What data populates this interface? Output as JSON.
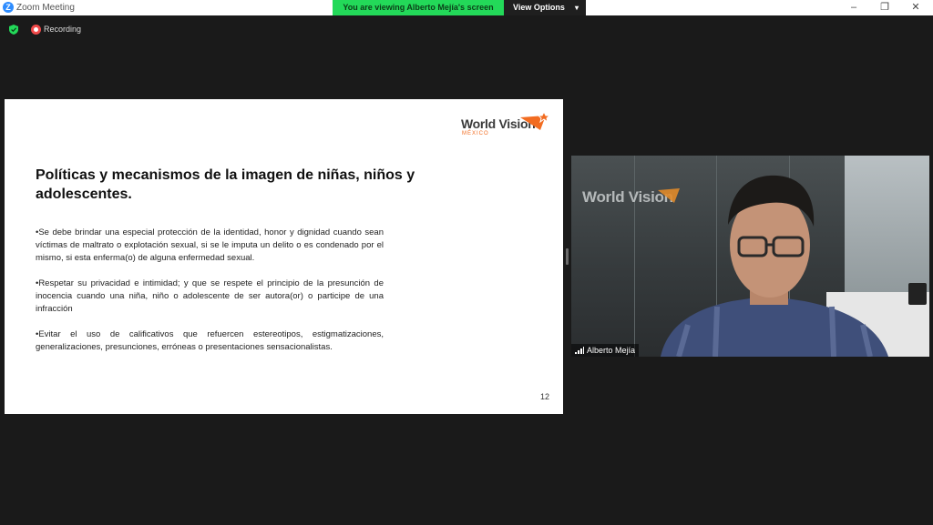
{
  "window": {
    "title": "Zoom Meeting",
    "minimize_glyph": "–",
    "maximize_glyph": "❐",
    "close_glyph": "✕",
    "app_icon_glyph": "Z"
  },
  "share_banner": {
    "text": "You are viewing Alberto Mejía's screen",
    "view_options": "View Options",
    "color": "#23d959"
  },
  "meeting_status": {
    "recording_label": "Recording"
  },
  "slide": {
    "logo_text": "World Vision",
    "logo_sub": "MÉXICO",
    "title": "Políticas y mecanismos de la imagen de niñas, niños y adolescentes.",
    "bullets": [
      "•Se debe brindar una especial protección de la identidad, honor y dignidad cuando sean víctimas de maltrato o explotación sexual, si se le imputa un delito o es condenado por el mismo, si esta enferma(o) de alguna enfermedad sexual.",
      "•Respetar su privacidad e intimidad; y que se respete el principio de la presunción de inocencia cuando una niña, niño o adolescente de ser autora(or) o participe de una infracción",
      "•Evitar el uso de calificativos que refuercen estereotipos, estigmatizaciones, generalizaciones, presunciones, erróneas o presentaciones sensacionalistas."
    ],
    "page_number": "12",
    "accent_color": "#f26c21"
  },
  "participant": {
    "name": "Alberto Mejía",
    "wall_logo": "World Vision"
  }
}
